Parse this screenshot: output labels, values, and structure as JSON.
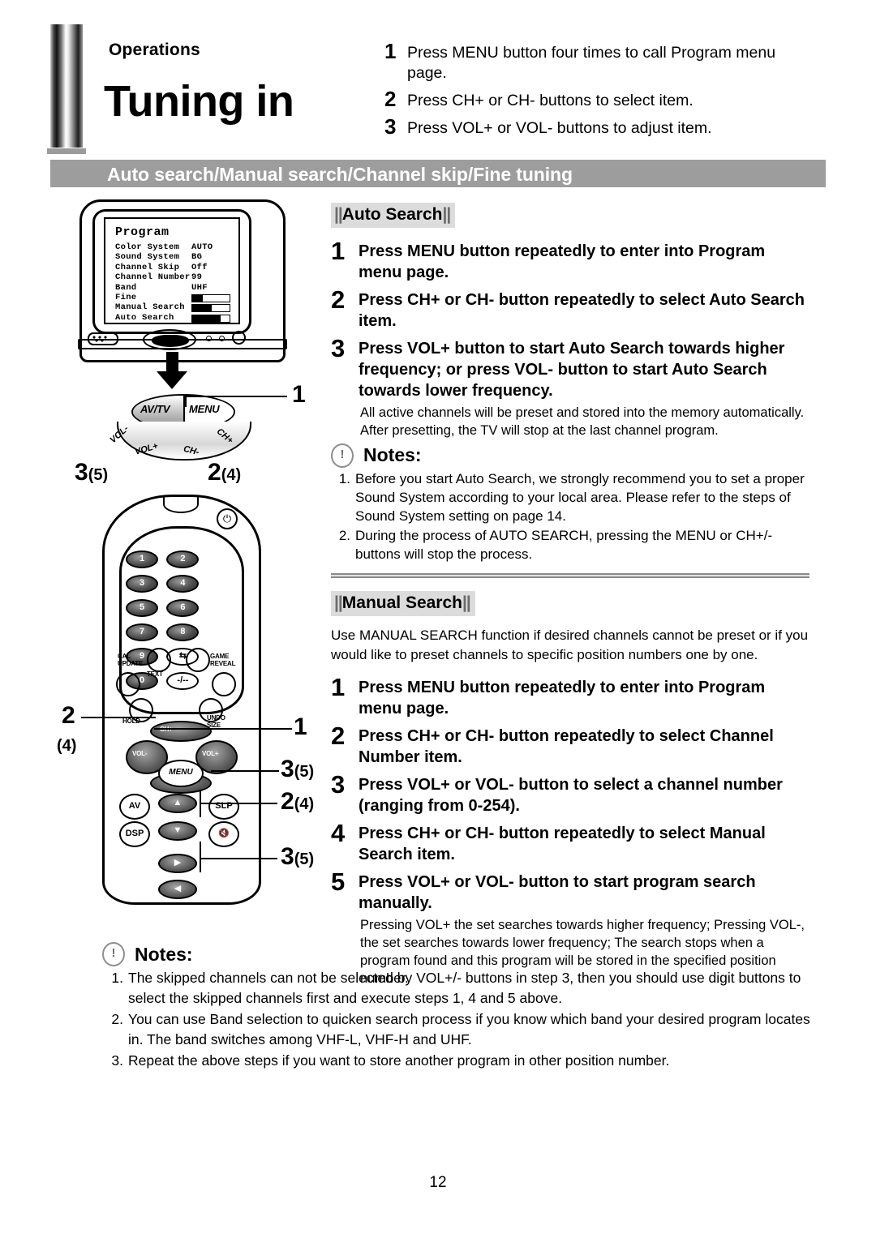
{
  "header": {
    "kicker": "Operations",
    "title": "Tuning in",
    "steps": [
      {
        "num": "1",
        "text": "Press MENU button four times to call Program menu page."
      },
      {
        "num": "2",
        "text": "Press CH+ or CH- buttons to select item."
      },
      {
        "num": "3",
        "text": "Press VOL+ or VOL- buttons to adjust item."
      }
    ]
  },
  "banner": {
    "label": "Auto search/Manual search/Channel skip/Fine tuning",
    "bg": "#9d9d9d",
    "text_color": "#ffffff"
  },
  "tv_osd": {
    "title": "Program",
    "rows": [
      {
        "label": "Color System",
        "value": "AUTO"
      },
      {
        "label": "Sound System",
        "value": "BG"
      },
      {
        "label": "Channel Skip",
        "value": "Off"
      },
      {
        "label": "Channel Number",
        "value": "99"
      },
      {
        "label": "Band",
        "value": "UHF"
      }
    ],
    "bars": [
      {
        "label": "Fine",
        "fill": 28
      },
      {
        "label": "Manual Search",
        "fill": 52
      },
      {
        "label": "Auto Search",
        "fill": 76
      }
    ]
  },
  "tv_controls": {
    "avtv": "AV/TV",
    "menu": "MENU",
    "vol_minus": "VOL-",
    "vol_plus": "VOL+",
    "ch_minus": "CH-",
    "ch_plus": "CH+",
    "callouts": {
      "menu": "1",
      "vol": "3",
      "vol_sub": "(5)",
      "ch": "2",
      "ch_sub": "(4)"
    }
  },
  "remote": {
    "power_icon": "power-icon",
    "keys": [
      "1",
      "2",
      "3",
      "4",
      "5",
      "6",
      "7",
      "8",
      "9"
    ],
    "key_swap": "⇆",
    "key_zero": "0",
    "key_dash": "-/--",
    "labels": {
      "cal_update": "CAL\nUPDATE",
      "text": "TEXT",
      "game_reveal": "GAME\nREVEAL",
      "hold": "HOLD",
      "undo_size": "UNDO\nSIZE",
      "ch_up": "CH+",
      "vol_down": "VOL-",
      "vol_up": "VOL+",
      "menu": "MENU",
      "av": "AV",
      "dsp": "DSP",
      "slp": "SLP",
      "mute": "mute-icon"
    },
    "callouts": {
      "menu": "1",
      "ch_left": "2",
      "ch_left_sub": "(4)",
      "vol_right": "3",
      "vol_right_sub": "(5)",
      "up_down": "2",
      "up_down_sub": "(4)",
      "left_right": "3",
      "left_right_sub": "(5)"
    }
  },
  "auto_search": {
    "heading": "Auto Search",
    "steps": [
      {
        "num": "1",
        "text": "Press MENU button repeatedly to enter into Program menu page."
      },
      {
        "num": "2",
        "text": "Press CH+ or CH- button repeatedly to select Auto Search item."
      },
      {
        "num": "3",
        "text": "Press VOL+ button to start Auto Search towards higher frequency; or press VOL- button to start Auto Search towards lower frequency."
      }
    ],
    "body": "All active channels will be preset and stored into the memory automatically. After presetting, the TV will stop at the last channel program.",
    "notes_title": "Notes:",
    "notes": [
      {
        "n": "1.",
        "text": "Before you start Auto Search, we strongly recommend you to set a proper Sound System according to your local area. Please refer to the steps of Sound System setting on page 14."
      },
      {
        "n": "2.",
        "text": "During the process of AUTO SEARCH, pressing the MENU or CH+/- buttons will stop the process."
      }
    ]
  },
  "manual_search": {
    "heading": "Manual Search",
    "lead": "Use MANUAL SEARCH function if desired channels cannot be preset or if you would like to preset channels to specific position numbers one by one.",
    "steps": [
      {
        "num": "1",
        "text": "Press MENU button repeatedly to enter into Program menu page."
      },
      {
        "num": "2",
        "text": "Press CH+ or CH- button repeatedly to select Channel Number item."
      },
      {
        "num": "3",
        "text": "Press VOL+ or VOL- button to select a channel number (ranging from 0-254)."
      },
      {
        "num": "4",
        "text": "Press CH+ or CH- button repeatedly to select Manual Search item."
      },
      {
        "num": "5",
        "text": "Press VOL+ or VOL- button to start program search manually."
      }
    ],
    "body": "Pressing VOL+ the set searches towards higher frequency; Pressing VOL-, the set searches towards lower frequency; The search stops when a program found and this program will be stored in the specified position number."
  },
  "bottom_notes": {
    "title": "Notes:",
    "items": [
      {
        "n": "1.",
        "text": "The skipped channels can not be selected by VOL+/- buttons in step 3, then you should use digit buttons to select the skipped channels first and execute steps 1, 4 and 5 above."
      },
      {
        "n": "2.",
        "text": "You can use Band selection to quicken search process if you know which band your desired program locates in. The band switches among VHF-L, VHF-H and UHF."
      },
      {
        "n": "3.",
        "text": "Repeat the above steps if you want to store another program in other position number."
      }
    ]
  },
  "page_number": "12"
}
